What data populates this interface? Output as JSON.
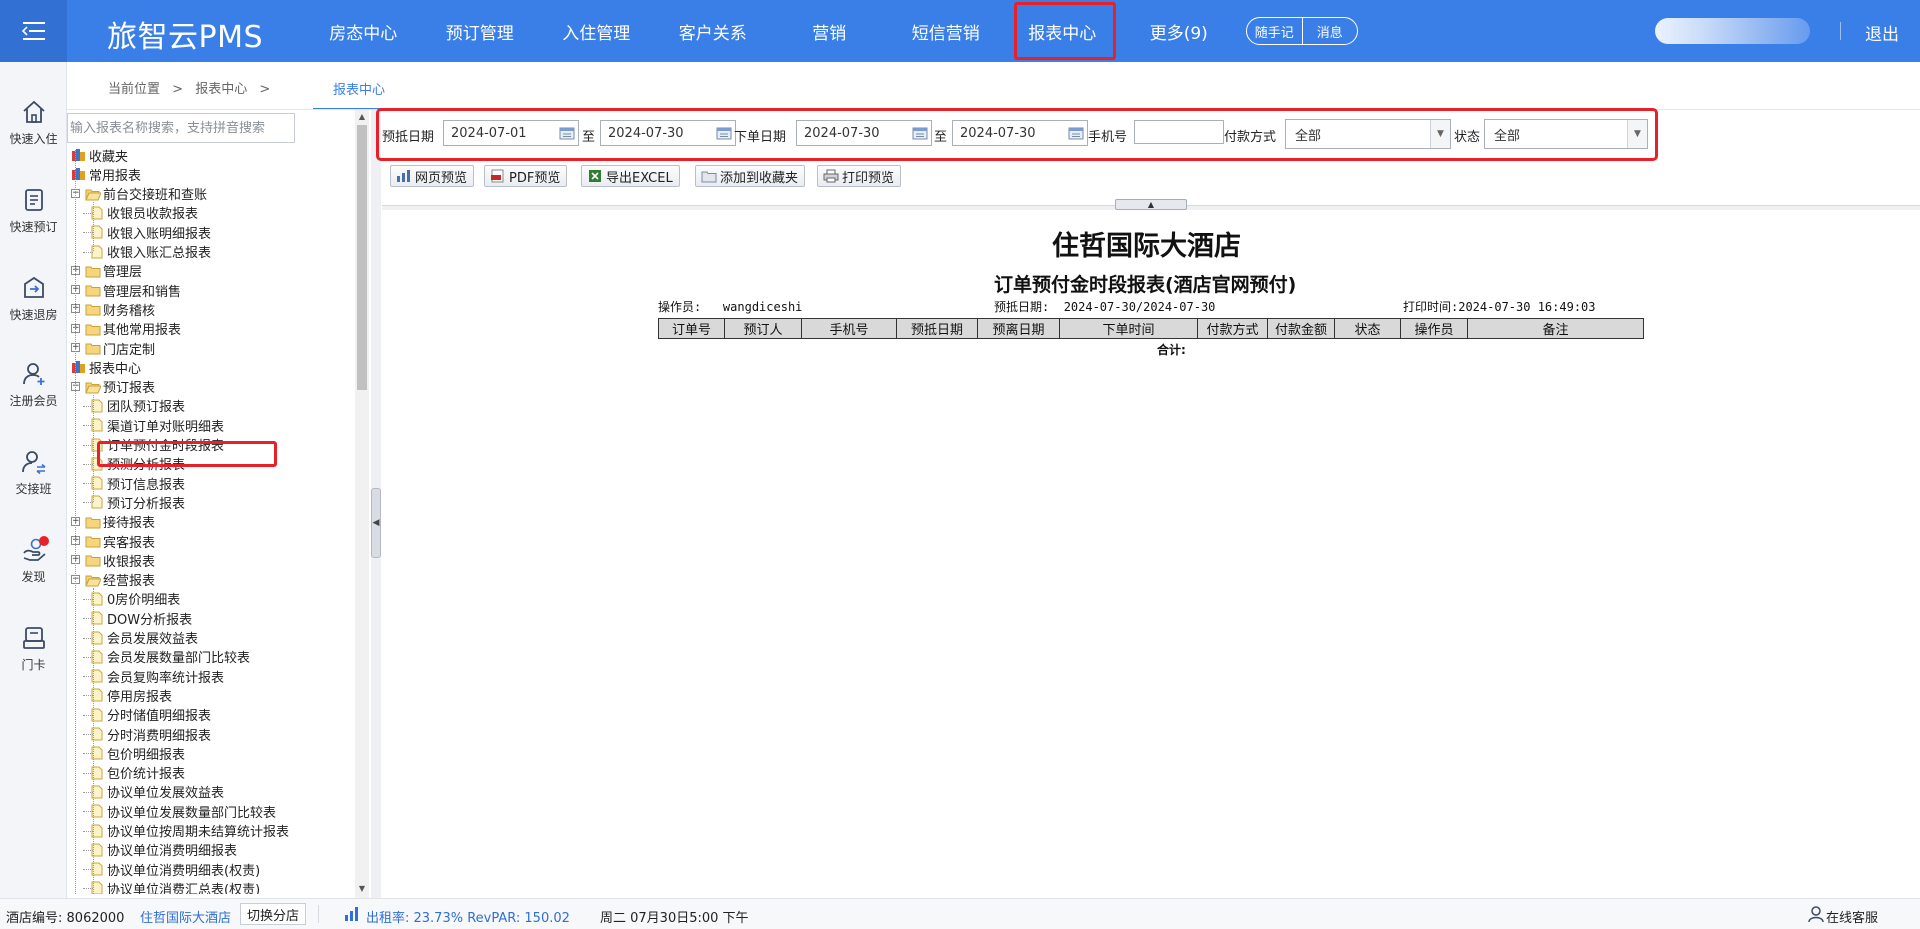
{
  "brand": "旅智云PMS",
  "nav": [
    "房态中心",
    "预订管理",
    "入住管理",
    "客户关系",
    "营销",
    "短信营销",
    "报表中心",
    "更多(9)"
  ],
  "nav_active_index": 6,
  "pill": {
    "left": "随手记",
    "right": "消息"
  },
  "logout": "退出",
  "rail": [
    "快速入住",
    "快速预订",
    "快速退房",
    "注册会员",
    "交接班",
    "发现",
    "门卡"
  ],
  "breadcrumb": [
    "当前位置",
    ">",
    "报表中心",
    ">"
  ],
  "active_tab": "报表中心",
  "search_placeholder": "输入报表名称搜索，支持拼音搜索",
  "tree": {
    "favorites": "收藏夹",
    "common": "常用报表",
    "common_children": [
      {
        "label": "前台交接班和查账",
        "expanded": true,
        "children": [
          "收银员收款报表",
          "收银入账明细报表",
          "收银入账汇总报表"
        ]
      },
      {
        "label": "管理层"
      },
      {
        "label": "管理层和销售"
      },
      {
        "label": "财务稽核"
      },
      {
        "label": "其他常用报表"
      },
      {
        "label": "门店定制"
      }
    ],
    "report_center": "报表中心",
    "booking": "预订报表",
    "booking_children": [
      "团队预订报表",
      "渠道订单对账明细表",
      "订单预付金时段报表",
      "预测分析报表",
      "预订信息报表",
      "预订分析报表"
    ],
    "more_groups": [
      "接待报表",
      "宾客报表",
      "收银报表"
    ],
    "ops": "经营报表",
    "ops_children": [
      "0房价明细表",
      "DOW分析报表",
      "会员发展效益表",
      "会员发展数量部门比较表",
      "会员复购率统计报表",
      "停用房报表",
      "分时储值明细报表",
      "分时消费明细报表",
      "包价明细报表",
      "包价统计报表",
      "协议单位发展效益表",
      "协议单位发展数量部门比较表",
      "协议单位按周期未结算统计报表",
      "协议单位消费明细报表",
      "协议单位消费明细表(权责)",
      "协议单位消费汇总表(权责)"
    ]
  },
  "filters": {
    "prepay_date_label": "预抵日期",
    "prepay_from": "2024-07-01",
    "to_label": "至",
    "prepay_to": "2024-07-30",
    "order_date_label": "下单日期",
    "order_from": "2024-07-30",
    "order_to": "2024-07-30",
    "phone_label": "手机号",
    "phone_value": "",
    "pay_label": "付款方式",
    "pay_value": "全部",
    "status_label": "状态",
    "status_value": "全部"
  },
  "toolbar": [
    "网页预览",
    "PDF预览",
    "导出EXCEL",
    "添加到收藏夹",
    "打印预览"
  ],
  "report": {
    "hotel": "住哲国际大酒店",
    "title": "订单预付金时段报表(酒店官网预付)",
    "operator_label": "操作员:",
    "operator": "wangdiceshi",
    "date_label": "预抵日期:",
    "date_range": "2024-07-30/2024-07-30",
    "print_label": "打印时间:",
    "print_time": "2024-07-30 16:49:03",
    "columns": [
      "订单号",
      "预订人",
      "手机号",
      "预抵日期",
      "预离日期",
      "下单时间",
      "付款方式",
      "付款金额",
      "状态",
      "操作员",
      "备注"
    ],
    "total_label": "合计:"
  },
  "status": {
    "hotel_no_label": "酒店编号:",
    "hotel_no": "8062000",
    "hotel_name": "住哲国际大酒店",
    "switch_store": "切换分店",
    "occupancy": "出租率: 23.73% RevPAR: 150.02",
    "datetime": "周二 07月30日5:00 下午",
    "support": "在线客服"
  },
  "colors": {
    "primary": "#3a7ee7",
    "highlight": "#e8202a",
    "link": "#2f6fd6"
  }
}
